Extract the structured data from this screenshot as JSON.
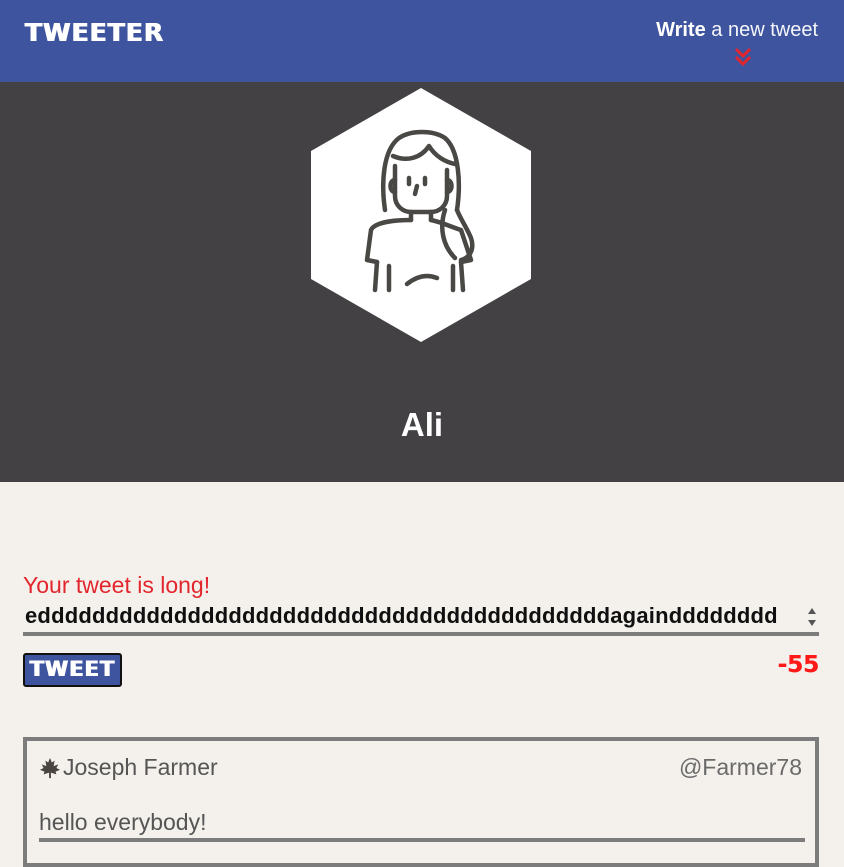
{
  "header": {
    "logo": "TWEETER",
    "compose_strong": "Write",
    "compose_light": "a new tweet",
    "chevron_icon": "double-chevron-down-icon",
    "chevron_color": "#e3262d",
    "background_color": "#3e549e"
  },
  "profile": {
    "avatar_icon": "woman-avatar-icon",
    "name": "Ali",
    "background_color": "#434144"
  },
  "composer": {
    "error": "Your tweet is long!",
    "value": "eddddddddddddddddddddddddddddddddddddddddddagaindddddddd",
    "submit_label": "TWEET",
    "counter": "-55",
    "error_color": "#e3262d"
  },
  "tweets": [
    {
      "flag_icon": "maple-leaf-icon",
      "author": "Joseph Farmer",
      "handle": "@Farmer78",
      "content": "hello everybody!"
    }
  ]
}
